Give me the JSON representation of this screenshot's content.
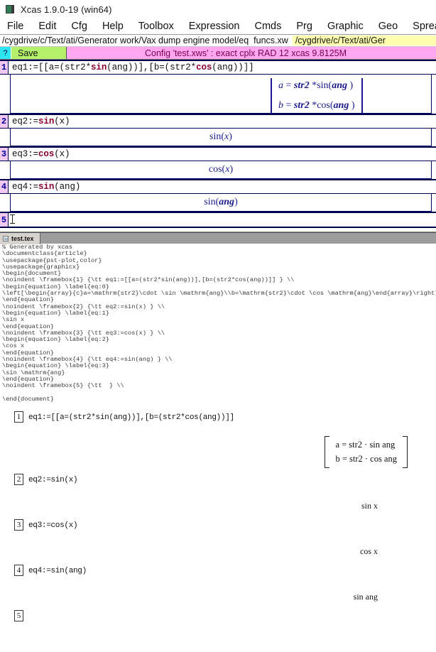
{
  "window": {
    "title": "Xcas 1.9.0-19 (win64)",
    "icon": "app-icon"
  },
  "menubar": {
    "items": [
      {
        "label": "File"
      },
      {
        "label": "Edit"
      },
      {
        "label": "Cfg"
      },
      {
        "label": "Help"
      },
      {
        "label": "Toolbox"
      },
      {
        "label": "Expression"
      },
      {
        "label": "Cmds"
      },
      {
        "label": "Prg"
      },
      {
        "label": "Graphic"
      },
      {
        "label": "Geo"
      },
      {
        "label": "Spreadsheet"
      }
    ]
  },
  "pathbar": {
    "directory": "/cygdrive/c/Text/ati/Generator work/Vax dump engine model/eq",
    "filename": "funcs.xw",
    "highlighted_path": "/cygdrive/c/Text/ati/Ger"
  },
  "toolbar": {
    "help_label": "?",
    "save_label": "Save",
    "config_status": "Config 'test.xws' : exact cplx RAD 12 xcas 9.8125M"
  },
  "worksheet": {
    "cells": [
      {
        "number": "1",
        "input_pre": "eq1:=[[a=(str2*",
        "input_kw1": "sin",
        "input_mid": "(ang))],[b=(str2*",
        "input_kw2": "cos",
        "input_post": "(ang))]]",
        "output_type": "matrix",
        "matrix_rows": [
          {
            "lhs": "a",
            "eq": " = ",
            "var": "str2",
            "op": " *",
            "fn": "sin(",
            "arg": "ang",
            "close": " )"
          },
          {
            "lhs": "b",
            "eq": " = ",
            "var": "str2",
            "op": " *",
            "fn": "cos(",
            "arg": "ang",
            "close": " )"
          }
        ]
      },
      {
        "number": "2",
        "input_pre": "eq2:=",
        "input_kw1": "sin",
        "input_post": "(x)",
        "output_type": "simple",
        "out_fn": "sin(",
        "out_arg": "x",
        "out_close": ")"
      },
      {
        "number": "3",
        "input_pre": "eq3:=",
        "input_kw1": "cos",
        "input_post": "(x)",
        "output_type": "simple",
        "out_fn": "cos(",
        "out_arg": "x",
        "out_close": ")"
      },
      {
        "number": "4",
        "input_pre": "eq4:=",
        "input_kw1": "sin",
        "input_post": "(ang)",
        "output_type": "simple",
        "out_fn": "sin(",
        "out_arg": "ang",
        "out_close": " )"
      },
      {
        "number": "5",
        "input_pre": "",
        "input_kw1": "",
        "input_post": "",
        "output_type": "none"
      }
    ]
  },
  "tex_panel": {
    "tab_label": "test.tex",
    "source": "% Generated by xcas\n\\documentclass{article}\n\\usepackage{pst-plot,color}\n\\usepackage{graphicx}\n\\begin{document}\n\\noindent \\framebox{1} {\\tt eq1:=[[a=(str2*sin(ang))],[b=(str2*cos(ang))]] } \\\\\n\\begin{equation} \\label{eq:0}\n\\left[\\begin{array}{c}a=\\mathrm{str2}\\cdot \\sin \\mathrm{ang}\\\\b=\\mathrm{str2}\\cdot \\cos \\mathrm{ang}\\end{array}\\right]\n\\end{equation}\n\\noindent \\framebox{2} {\\tt eq2:=sin(x) } \\\\\n\\begin{equation} \\label{eq:1}\n\\sin x\n\\end{equation}\n\\noindent \\framebox{3} {\\tt eq3:=cos(x) } \\\\\n\\begin{equation} \\label{eq:2}\n\\cos x\n\\end{equation}\n\\noindent \\framebox{4} {\\tt eq4:=sin(ang) } \\\\\n\\begin{equation} \\label{eq:3}\n\\sin \\mathrm{ang}\n\\end{equation}\n\\noindent \\framebox{5} {\\tt  } \\\\\n\n\\end{document}"
  },
  "preview": {
    "entries": [
      {
        "number": "1",
        "code": "eq1:=[[a=(str2*sin(ang))],[b=(str2*cos(ang))]]",
        "render_type": "matrix",
        "matrix_rows": [
          "a = str2 · sin ang",
          "b = str2 · cos ang"
        ]
      },
      {
        "number": "2",
        "code": "eq2:=sin(x)",
        "render_type": "equation",
        "rendered": "sin x"
      },
      {
        "number": "3",
        "code": "eq3:=cos(x)",
        "render_type": "equation",
        "rendered": "cos x"
      },
      {
        "number": "4",
        "code": "eq4:=sin(ang)",
        "render_type": "equation",
        "rendered": "sin ang"
      },
      {
        "number": "5",
        "code": "",
        "render_type": "none",
        "rendered": ""
      }
    ]
  },
  "colors": {
    "cell_number_bg": "#f0c8f0",
    "cell_number_fg": "#0000a0",
    "output_text": "#1a1a8c",
    "keyword": "#8b0030",
    "config_bar": "#ffa6f0",
    "save_button": "#b4f06a",
    "help_button": "#2ee6f2",
    "path_highlight": "#ffffb0"
  }
}
